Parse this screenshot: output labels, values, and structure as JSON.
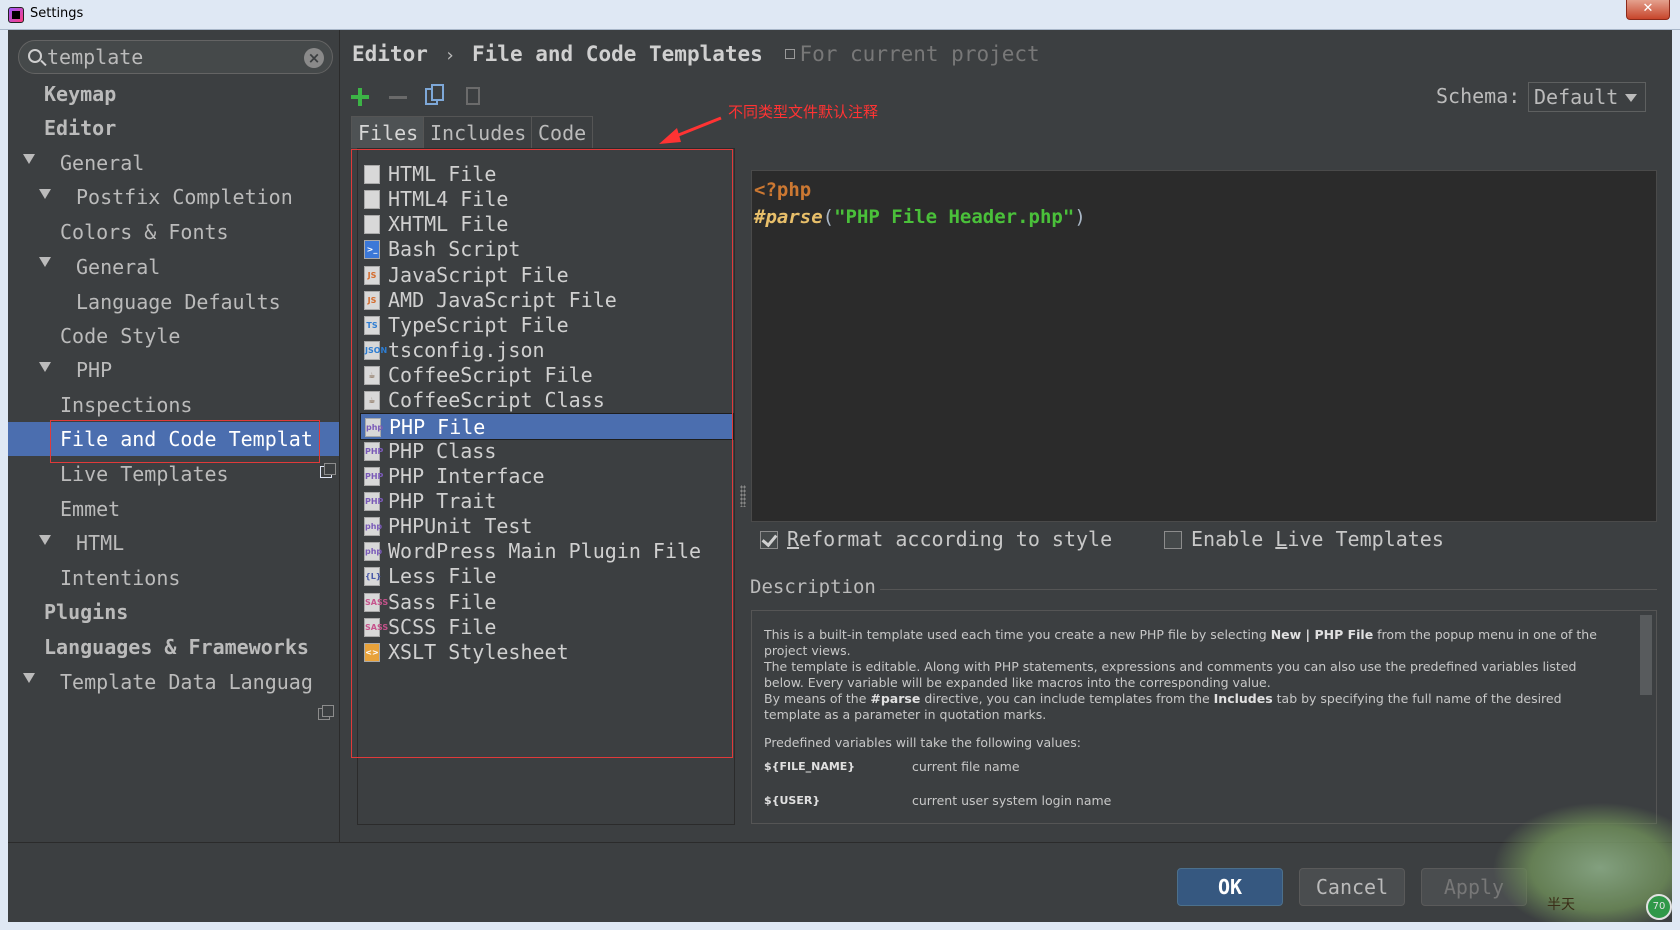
{
  "window": {
    "title": "Settings",
    "close_label": "✕"
  },
  "search": {
    "value": "template"
  },
  "sidebar": {
    "items": [
      {
        "label": "Keymap"
      },
      {
        "label": "Editor"
      },
      {
        "label": "General"
      },
      {
        "label": "Postfix Completion"
      },
      {
        "label": "Colors & Fonts"
      },
      {
        "label": "General"
      },
      {
        "label": "Language Defaults"
      },
      {
        "label": "Code Style"
      },
      {
        "label": "PHP"
      },
      {
        "label": "Inspections"
      },
      {
        "label": "File and Code Templat"
      },
      {
        "label": "Live Templates"
      },
      {
        "label": "Emmet"
      },
      {
        "label": "HTML"
      },
      {
        "label": "Intentions"
      },
      {
        "label": "Plugins"
      },
      {
        "label": "Languages & Frameworks"
      },
      {
        "label": "Template Data Languag"
      }
    ]
  },
  "breadcrumb": {
    "part1": "Editor",
    "separator": "›",
    "part2": "File and Code Templates",
    "scope": "For current project"
  },
  "schema": {
    "label": "Schema:",
    "value": "Default"
  },
  "tabs": [
    {
      "label": "Files"
    },
    {
      "label": "Includes"
    },
    {
      "label": "Code"
    }
  ],
  "annotation": "不同类型文件默认注释",
  "files": [
    {
      "label": "HTML File",
      "icon": "html-file-icon",
      "badge": ""
    },
    {
      "label": "HTML4 File",
      "icon": "html-file-icon",
      "badge": ""
    },
    {
      "label": "XHTML File",
      "icon": "xhtml-file-icon",
      "badge": ""
    },
    {
      "label": "Bash Script",
      "icon": "terminal-icon",
      "badge": ">_"
    },
    {
      "label": "JavaScript File",
      "icon": "javascript-file-icon",
      "badge": "JS"
    },
    {
      "label": "AMD JavaScript File",
      "icon": "javascript-file-icon",
      "badge": "JS"
    },
    {
      "label": "TypeScript File",
      "icon": "typescript-file-icon",
      "badge": "TS"
    },
    {
      "label": "tsconfig.json",
      "icon": "json-file-icon",
      "badge": "JSON"
    },
    {
      "label": "CoffeeScript File",
      "icon": "coffee-file-icon",
      "badge": "☕"
    },
    {
      "label": "CoffeeScript Class",
      "icon": "coffee-file-icon",
      "badge": "☕"
    },
    {
      "label": "PHP File",
      "icon": "php-file-icon",
      "badge": "php"
    },
    {
      "label": "PHP Class",
      "icon": "php-file-icon",
      "badge": "PHP"
    },
    {
      "label": "PHP Interface",
      "icon": "php-file-icon",
      "badge": "PHP"
    },
    {
      "label": "PHP Trait",
      "icon": "php-file-icon",
      "badge": "PHP"
    },
    {
      "label": "PHPUnit Test",
      "icon": "php-file-icon",
      "badge": "php"
    },
    {
      "label": "WordPress Main Plugin File",
      "icon": "php-file-icon",
      "badge": "php"
    },
    {
      "label": "Less File",
      "icon": "less-file-icon",
      "badge": "{L}"
    },
    {
      "label": "Sass File",
      "icon": "sass-file-icon",
      "badge": "SASS"
    },
    {
      "label": "SCSS File",
      "icon": "scss-file-icon",
      "badge": "SASS"
    },
    {
      "label": "XSLT Stylesheet",
      "icon": "xslt-file-icon",
      "badge": "<>"
    }
  ],
  "selected_file": "PHP File",
  "editor": {
    "line1": "<?php",
    "directive": "#parse",
    "open_paren": "(",
    "string": "\"PHP File Header.php\"",
    "close_paren": ")"
  },
  "options": {
    "reformat_pre": "",
    "reformat_key": "R",
    "reformat_post": "eformat according to style",
    "reformat_checked": true,
    "live_pre": "Enable ",
    "live_key": "L",
    "live_post": "ive Templates",
    "live_checked": false
  },
  "description": {
    "title": "Description",
    "p1_a": "This is a built-in template used each time you create a new PHP file by selecting ",
    "p1_b": "New | PHP File",
    "p1_c": " from the popup menu in one of the project views.",
    "p2": "The template is editable. Along with PHP statements, expressions and comments you can also use the predefined variables listed below. Every variable will be expanded like macros into the corresponding value.",
    "p3_a": "By means of the ",
    "p3_b": "#parse",
    "p3_c": " directive, you can include templates from the ",
    "p3_d": "Includes",
    "p3_e": " tab by specifying the full name of the desired template as a parameter in quotation marks.",
    "p4": "Predefined variables will take the following values:",
    "vars": [
      {
        "name": "${FILE_NAME}",
        "desc": "current file name"
      },
      {
        "name": "${USER}",
        "desc": "current user system login name"
      }
    ]
  },
  "buttons": {
    "ok": "OK",
    "cancel": "Cancel",
    "apply": "Apply"
  },
  "watermark": {
    "text": "半天",
    "badge": "70"
  },
  "colors": {
    "selection": "#4b6eaf",
    "annotation": "#ff3333",
    "ok_button": "#365880"
  }
}
